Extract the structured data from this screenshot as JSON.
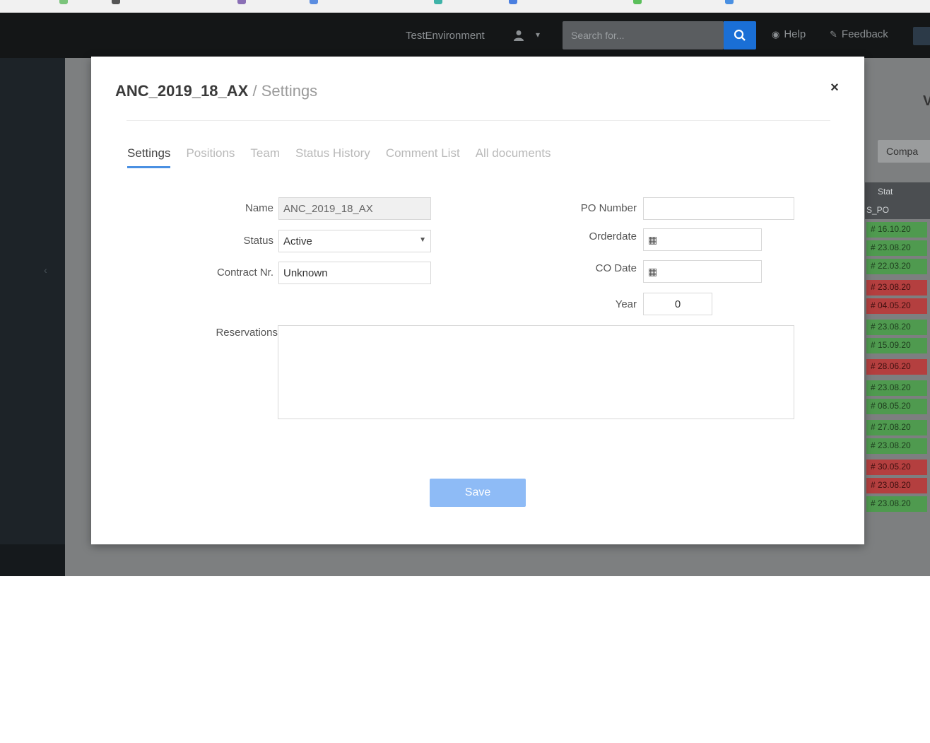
{
  "topnav": {
    "environment": "TestEnvironment",
    "user_caret": "▾",
    "search_placeholder": "Search for...",
    "help_label": "Help",
    "feedback_label": "Feedback"
  },
  "modal": {
    "project_name": "ANC_2019_18_AX",
    "separator": " / ",
    "section_title": "Settings",
    "close_label": "×",
    "tabs": [
      {
        "label": "Settings",
        "active": true
      },
      {
        "label": "Positions",
        "active": false
      },
      {
        "label": "Team",
        "active": false
      },
      {
        "label": "Status History",
        "active": false
      },
      {
        "label": "Comment List",
        "active": false
      },
      {
        "label": "All documents",
        "active": false
      }
    ],
    "form": {
      "name_label": "Name",
      "name_value": "ANC_2019_18_AX",
      "status_label": "Status",
      "status_value": "Active",
      "contract_label": "Contract Nr.",
      "contract_value": "Unknown",
      "po_label": "PO Number",
      "po_value": "",
      "orderdate_label": "Orderdate",
      "orderdate_value": "",
      "co_date_label": "CO Date",
      "co_date_value": "",
      "year_label": "Year",
      "year_value": "0",
      "reservations_label": "Reservations",
      "reservations_value": ""
    },
    "save_label": "Save"
  },
  "background": {
    "right_heading": "V",
    "right_tab": "Compa",
    "right_header_1": "Stat",
    "right_header_2": "S_PO",
    "cells": [
      {
        "text": "# 16.10.20",
        "status": "green"
      },
      {
        "text": "# 23.08.20",
        "status": "green"
      },
      {
        "text": "# 22.03.20",
        "status": "green"
      },
      {
        "text": "# 23.08.20",
        "status": "red"
      },
      {
        "text": "# 04.05.20",
        "status": "red"
      },
      {
        "text": "# 23.08.20",
        "status": "green"
      },
      {
        "text": "# 15.09.20",
        "status": "green"
      },
      {
        "text": "# 28.06.20",
        "status": "red"
      },
      {
        "text": "# 23.08.20",
        "status": "green"
      },
      {
        "text": "# 08.05.20",
        "status": "green"
      },
      {
        "text": "# 27.08.20",
        "status": "green"
      },
      {
        "text": "# 23.08.20",
        "status": "green"
      },
      {
        "text": "# 30.05.20",
        "status": "red"
      },
      {
        "text": "# 23.08.20",
        "status": "red"
      },
      {
        "text": "# 23.08.20",
        "status": "green"
      }
    ]
  },
  "colors": {
    "accent": "#4a90e2",
    "save_button": "#8ebbf6",
    "search_button": "#1a6fd6",
    "nav_bg": "#141617",
    "status_green": "#4f9a4f",
    "status_red": "#b43f3f"
  }
}
